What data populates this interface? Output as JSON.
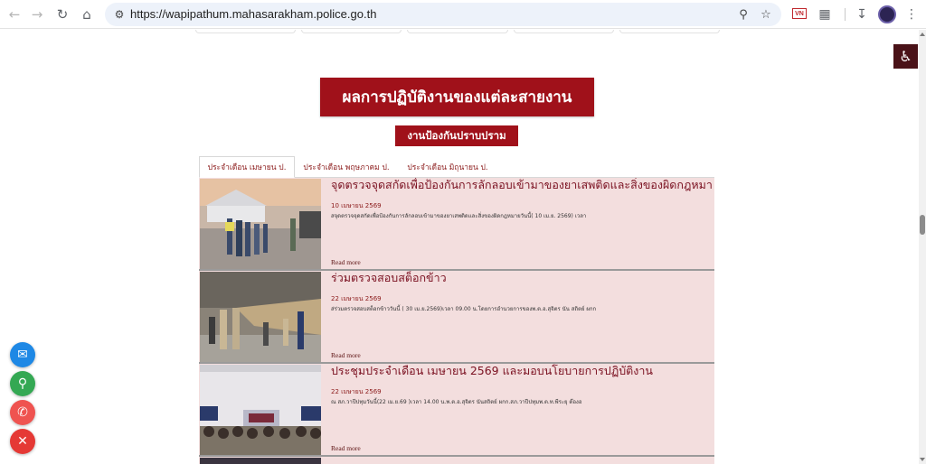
{
  "browser": {
    "url": "https://wapipathum.mahasarakham.police.go.th",
    "ext_label": "VN"
  },
  "page": {
    "main_title": "ผลการปฏิบัติงานของแต่ละสายงาน",
    "sub_title": "งานป้องกันปราบปราม",
    "tabs": [
      {
        "label": "ประจำเดือน เมษายน ป."
      },
      {
        "label": "ประจำเดือน พฤษภาคม ป."
      },
      {
        "label": "ประจำเดือน มิถุนายน ป."
      }
    ],
    "items": [
      {
        "title": "จุดตรวจจุดสกัดเพื่อป้องกันการลักลอบเข้ามาของยาเสพติดและสิ่งของผิดกฎหมาย",
        "date": "10 เมษายน 2569",
        "excerpt": "สจุดตรวจจุดสกัดเพื่อป้องกันการลักลอบเข้ามาของยาเสพติดและสิ่งของผิดกฎหมายวันนี้( 10 เม.ย. 2569) เวลา",
        "read_more": "Read more"
      },
      {
        "title": "ร่วมตรวจสอบสต็อกข้าว",
        "date": "22 เมษายน 2569",
        "excerpt": "ส่ร่วมตรวจสอบสต็อกข้าววันนี้ ( 30 เม.ย.2569)เวลา 09.00 น.โดยการอำนวยการของพ.ต.อ.สุจิตร นัน สถิตย์ ผกก",
        "read_more": "Read more"
      },
      {
        "title": "ประชุมประจำเดือน เมษายน 2569 และมอบนโยบายการปฏิบัติงาน",
        "date": "22 เมษายน 2569",
        "excerpt": "ณ สภ.วาปีปทุมวันนี้(22 เม.ย.69 )เวลา 14.00 น.พ.ต.อ.สุจิตร นันสถิตย์ ผกก.สภ.วาปีปทุมพ.ต.ท.พีระยุ ต๊องอ",
        "read_more": "Read more"
      }
    ]
  },
  "colors": {
    "brand_red": "#a0111a",
    "card_bg": "#f3dede",
    "messenger": "#1e88e5",
    "map": "#34a853",
    "phone": "#ef5350",
    "close": "#e53935"
  },
  "icons": {
    "back": "arrow-left-icon",
    "forward": "arrow-right-icon",
    "reload": "reload-icon",
    "home": "home-icon",
    "accessibility": "wheelchair-icon"
  }
}
